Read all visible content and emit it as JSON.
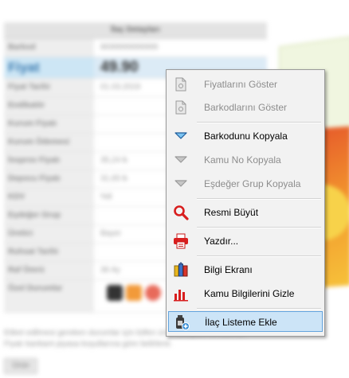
{
  "background": {
    "table_header": "İlaç Detayları",
    "rows": [
      {
        "label": "Barkod",
        "value": "8699999999999"
      },
      {
        "label": "Fiyat",
        "value": "49.90"
      },
      {
        "label": "Fiyat Tarihi",
        "value": "01.03.2019"
      },
      {
        "label": "Endikatör",
        "value": ""
      },
      {
        "label": "Kurum Fiyatı",
        "value": ""
      },
      {
        "label": "Kurum Ödemesi",
        "value": ""
      },
      {
        "label": "İnsprox Fiyatı",
        "value": "35,24 ₺"
      },
      {
        "label": "Depocu Fiyatı",
        "value": "31,65 ₺"
      },
      {
        "label": "KDV",
        "value": "%8"
      },
      {
        "label": "Eşdeğer Grup",
        "value": ""
      },
      {
        "label": "Üretici",
        "value": "Bayer"
      },
      {
        "label": "Ruhsat Tarihi",
        "value": ""
      },
      {
        "label": "Raf Ömrü",
        "value": "36 Ay"
      },
      {
        "label": "Özel Durumlar",
        "value": ""
      }
    ],
    "note": "Etiket edilmesi gereken durumlar için lütfen ürün detaylarına bakınız. Fiyatı kanbant piyasa koşullarına göre belirlenir.",
    "button": "Ürün"
  },
  "menu": {
    "items": [
      {
        "label": "Fiyatlarını Göster",
        "icon": "document-icon",
        "disabled": true
      },
      {
        "label": "Barkodlarını Göster",
        "icon": "document-icon",
        "disabled": true
      },
      {
        "label": "Barkodunu Kopyala",
        "icon": "triangle-down-icon",
        "disabled": false
      },
      {
        "label": "Kamu No Kopyala",
        "icon": "triangle-down-icon",
        "disabled": true
      },
      {
        "label": "Eşdeğer Grup Kopyala",
        "icon": "triangle-down-icon",
        "disabled": true
      },
      {
        "label": "Resmi Büyüt",
        "icon": "magnifier-icon",
        "disabled": false
      },
      {
        "label": "Yazdır...",
        "icon": "printer-icon",
        "disabled": false
      },
      {
        "label": "Bilgi Ekranı",
        "icon": "info-screen-icon",
        "disabled": false
      },
      {
        "label": "Kamu Bilgilerini Gizle",
        "icon": "bar-chart-icon",
        "disabled": false
      },
      {
        "label": "İlaç Listeme Ekle",
        "icon": "add-medicine-icon",
        "disabled": false,
        "selected": true
      }
    ]
  },
  "colors": {
    "menu_bg": "#f2f2f2",
    "selected_bg": "#cce4f7",
    "selected_border": "#62a3dd",
    "accent_red": "#d81e1e",
    "accent_blue": "#3a8fd6"
  }
}
